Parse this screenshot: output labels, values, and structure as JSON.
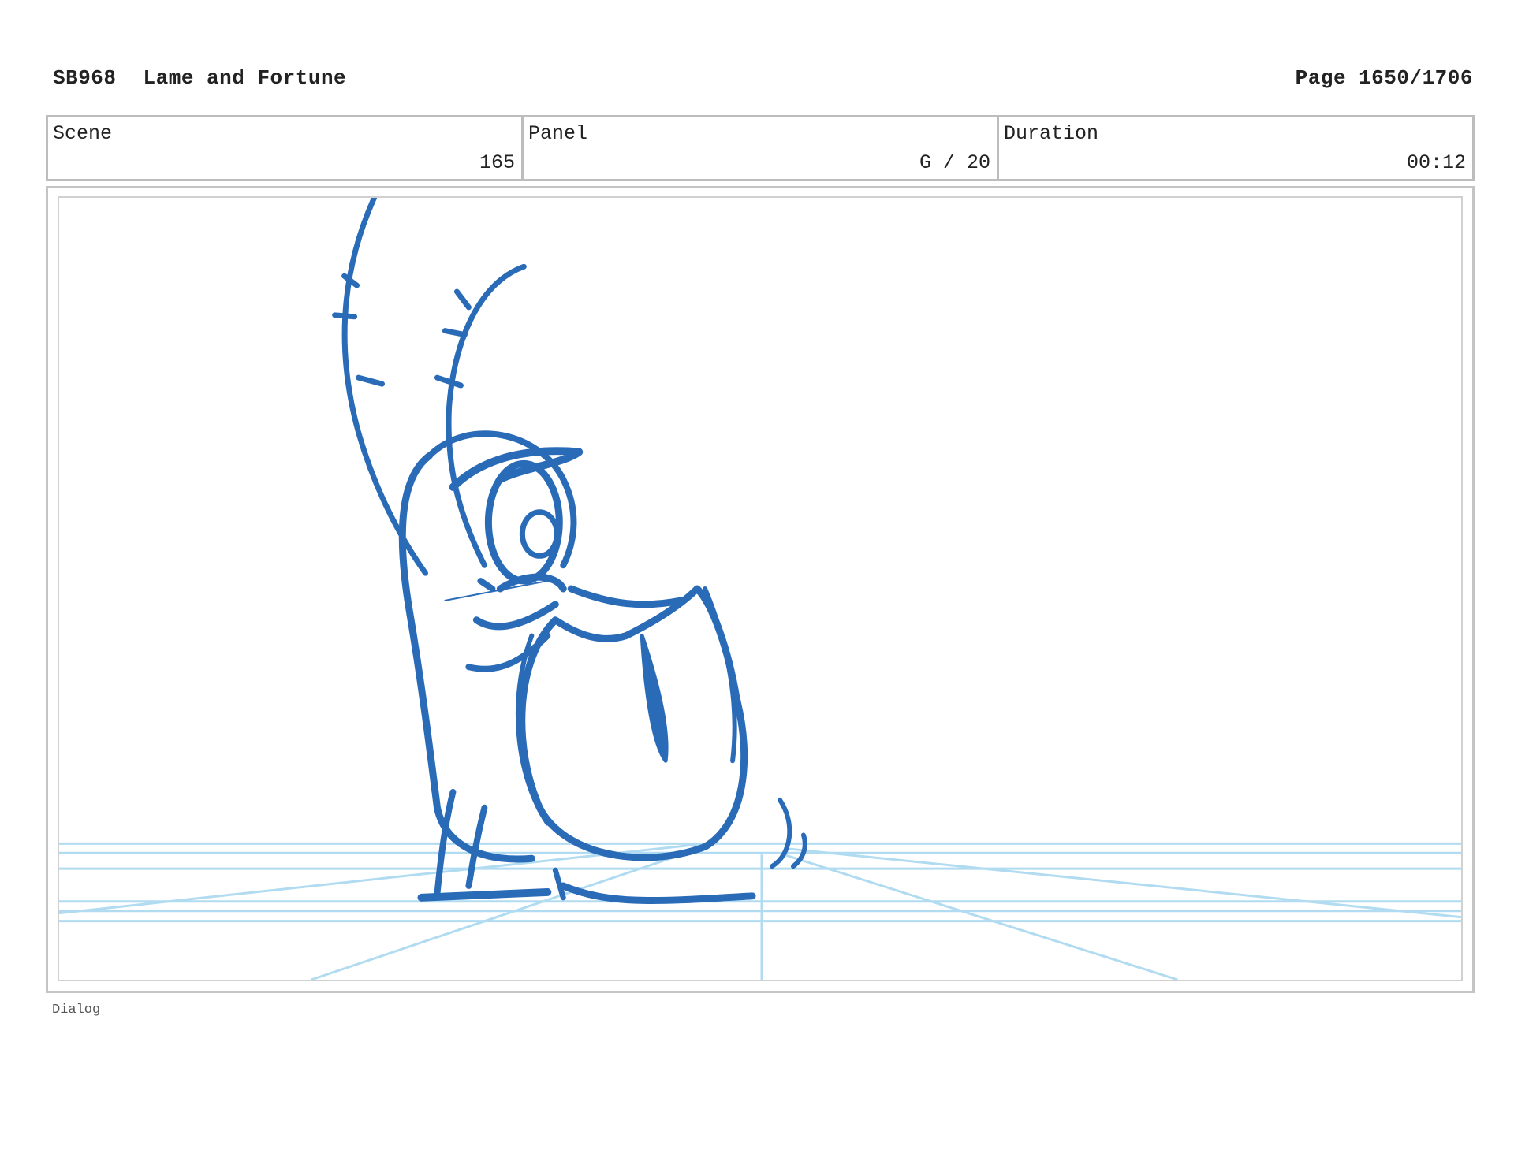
{
  "header": {
    "code": "SB968",
    "title": "Lame and Fortune",
    "page_label": "Page",
    "page_value": "1650/1706"
  },
  "info": {
    "scene_label": "Scene",
    "scene_value": "165",
    "panel_label": "Panel",
    "panel_value": "G / 20",
    "duration_label": "Duration",
    "duration_value": "00:12"
  },
  "panel": {
    "drawing": "plankton-sketch-icon",
    "line_color": "#2a6bb8",
    "guide_color": "#a8d8ef"
  },
  "dialog": {
    "label": "Dialog"
  }
}
